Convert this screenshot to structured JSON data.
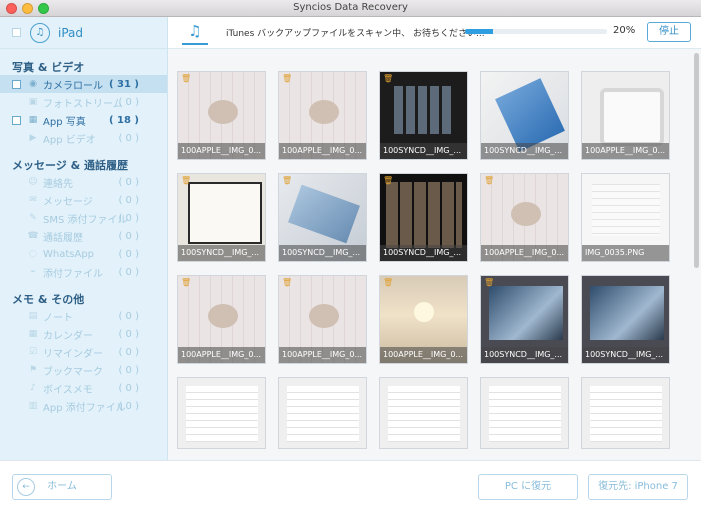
{
  "window": {
    "title": "Syncios Data Recovery"
  },
  "device": {
    "name": "iPad",
    "icon": "music-note-icon"
  },
  "sidebar": {
    "sections": [
      {
        "title": "写真 & ビデオ",
        "items": [
          {
            "label": "カメラロール",
            "count": "( 31 )",
            "state": "active",
            "checkbox": true,
            "selected": true,
            "icon": "camera-icon"
          },
          {
            "label": "フォトストリーム",
            "count": "( 0 )",
            "state": "inactive",
            "checkbox": false,
            "icon": "photostream-icon"
          },
          {
            "label": "App 写真",
            "count": "( 18 )",
            "state": "active",
            "checkbox": true,
            "icon": "image-icon"
          },
          {
            "label": "App ビデオ",
            "count": "( 0 )",
            "state": "inactive",
            "checkbox": false,
            "icon": "video-icon"
          }
        ]
      },
      {
        "title": "メッセージ & 通話履歴",
        "items": [
          {
            "label": "連絡先",
            "count": "( 0 )",
            "state": "inactive",
            "icon": "contacts-icon"
          },
          {
            "label": "メッセージ",
            "count": "( 0 )",
            "state": "inactive",
            "icon": "message-icon"
          },
          {
            "label": "SMS 添付ファイル",
            "count": "( 0 )",
            "state": "inactive",
            "icon": "attachment-icon"
          },
          {
            "label": "通話履歴",
            "count": "( 0 )",
            "state": "inactive",
            "icon": "phone-icon"
          },
          {
            "label": "WhatsApp",
            "count": "( 0 )",
            "state": "inactive",
            "icon": "whatsapp-icon"
          },
          {
            "label": "添付ファイル",
            "count": "( 0 )",
            "state": "inactive",
            "icon": "paperclip-icon"
          }
        ]
      },
      {
        "title": "メモ & その他",
        "items": [
          {
            "label": "ノート",
            "count": "( 0 )",
            "state": "inactive",
            "icon": "note-icon"
          },
          {
            "label": "カレンダー",
            "count": "( 0 )",
            "state": "inactive",
            "icon": "calendar-icon"
          },
          {
            "label": "リマインダー",
            "count": "( 0 )",
            "state": "inactive",
            "icon": "reminder-icon"
          },
          {
            "label": "ブックマーク",
            "count": "( 0 )",
            "state": "inactive",
            "icon": "bookmark-icon"
          },
          {
            "label": "ボイスメモ",
            "count": "( 0 )",
            "state": "inactive",
            "icon": "mic-icon"
          },
          {
            "label": "App 添付ファイル",
            "count": "( 0 )",
            "state": "inactive",
            "icon": "app-attachment-icon"
          }
        ]
      }
    ]
  },
  "scan": {
    "status_text": "iTunes バックアップファイルをスキャン中、 お待ちください...",
    "progress": 0.2,
    "percent_label": "20%",
    "stop_label": "停止"
  },
  "thumbnails": [
    {
      "caption": "100APPLE__IMG_0...",
      "kind": "cal",
      "trash": true
    },
    {
      "caption": "100APPLE__IMG_0...",
      "kind": "cal",
      "trash": true
    },
    {
      "caption": "100SYNCD__IMG_...",
      "kind": "dark",
      "trash": true
    },
    {
      "caption": "100SYNCD__IMG_...",
      "kind": "ipad",
      "trash": false
    },
    {
      "caption": "100APPLE__IMG_0...",
      "kind": "phone",
      "trash": false
    },
    {
      "caption": "100SYNCD__IMG_...",
      "kind": "book",
      "trash": true
    },
    {
      "caption": "100SYNCD__IMG_...",
      "kind": "ipad2",
      "trash": true
    },
    {
      "caption": "100SYNCD__IMG_...",
      "kind": "movies",
      "trash": true
    },
    {
      "caption": "100APPLE__IMG_0...",
      "kind": "cal",
      "trash": true
    },
    {
      "caption": "IMG_0035.PNG",
      "kind": "shot",
      "trash": false
    },
    {
      "caption": "100APPLE__IMG_0...",
      "kind": "cal",
      "trash": true
    },
    {
      "caption": "100APPLE__IMG_0...",
      "kind": "cal",
      "trash": true
    },
    {
      "caption": "100APPLE__IMG_0...",
      "kind": "sunset",
      "trash": true
    },
    {
      "caption": "100SYNCD__IMG_...",
      "kind": "game",
      "trash": true
    },
    {
      "caption": "100SYNCD__IMG_...",
      "kind": "game",
      "trash": false
    },
    {
      "caption": "",
      "kind": "set",
      "trash": false
    },
    {
      "caption": "",
      "kind": "set",
      "trash": false
    },
    {
      "caption": "",
      "kind": "set",
      "trash": false
    },
    {
      "caption": "",
      "kind": "set",
      "trash": false
    },
    {
      "caption": "",
      "kind": "set",
      "trash": false
    }
  ],
  "footer": {
    "home_label": "ホーム",
    "restore_pc_label": "PC に復元",
    "restore_device_label": "復元先: iPhone 7"
  },
  "colors": {
    "accent": "#2f9ee0",
    "sidebar_bg": "#e3f2fa",
    "selected_bg": "#c4e0f1"
  }
}
